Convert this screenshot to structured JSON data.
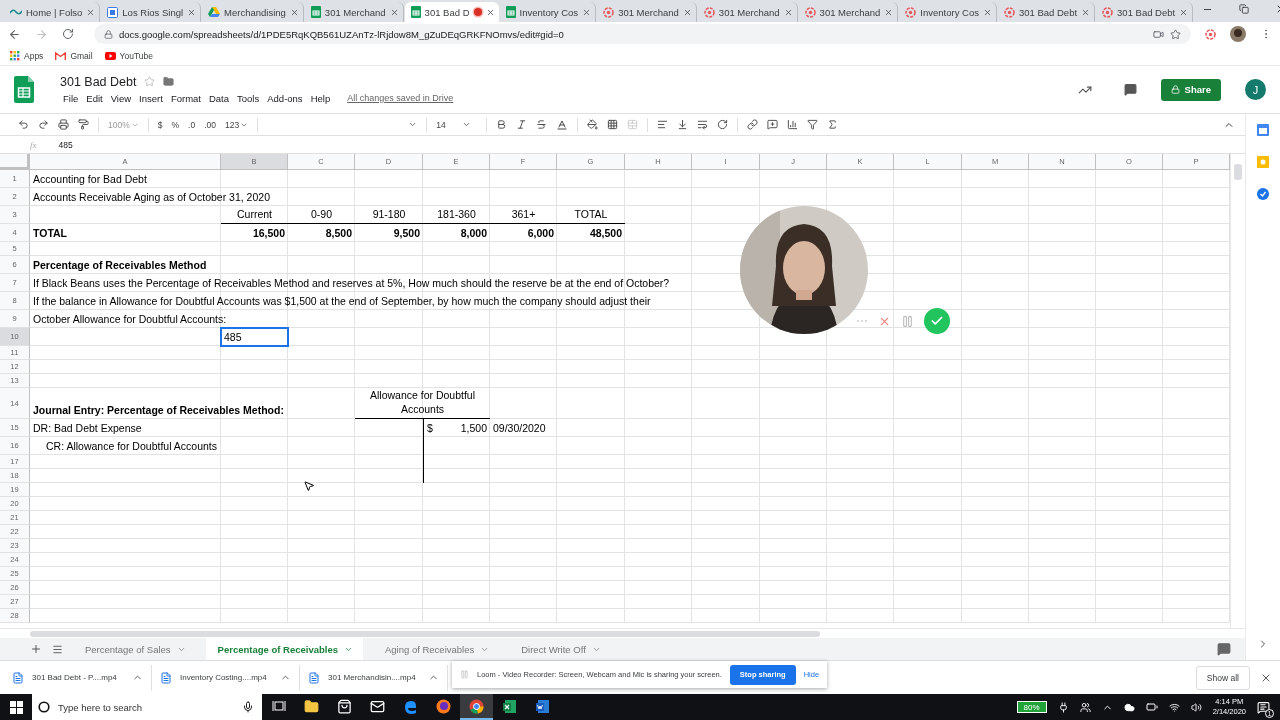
{
  "browser": {
    "tabs": [
      {
        "title": "Home | Folso",
        "kind": "site",
        "selected": false,
        "recording": false
      },
      {
        "title": "Los Rios Singl",
        "kind": "page",
        "selected": false,
        "recording": false
      },
      {
        "title": "Merchandising",
        "kind": "drive",
        "selected": false,
        "recording": false
      },
      {
        "title": "301 Merchand",
        "kind": "sheets",
        "selected": false,
        "recording": false
      },
      {
        "title": "301 Bad D",
        "kind": "sheets",
        "selected": true,
        "recording": true
      },
      {
        "title": "Inventory Cos",
        "kind": "sheets",
        "selected": false,
        "recording": false
      },
      {
        "title": "301 Merchand",
        "kind": "loom",
        "selected": false,
        "recording": false
      },
      {
        "title": "301 Merchand",
        "kind": "loom",
        "selected": false,
        "recording": false
      },
      {
        "title": "301 Merchand",
        "kind": "loom",
        "selected": false,
        "recording": false
      },
      {
        "title": "Inventory Cos",
        "kind": "loom",
        "selected": false,
        "recording": false
      },
      {
        "title": "301 Bad Debt",
        "kind": "loom",
        "selected": false,
        "recording": false
      },
      {
        "title": "301 Bad Debt",
        "kind": "loom",
        "selected": false,
        "recording": false
      }
    ],
    "url": "docs.google.com/spreadsheets/d/1PDE5RqKQB561UZAnTz-lRjdow8M_gZuDEqGRKFNOmvs/edit#gid=0",
    "bookmarks": [
      {
        "label": "Apps",
        "kind": "apps"
      },
      {
        "label": "Gmail",
        "kind": "gmail"
      },
      {
        "label": "YouTube",
        "kind": "youtube"
      }
    ]
  },
  "sheet_app": {
    "title": "301 Bad Debt",
    "menus": [
      "File",
      "Edit",
      "View",
      "Insert",
      "Format",
      "Data",
      "Tools",
      "Add-ons",
      "Help"
    ],
    "save_status": "All changes saved in Drive",
    "share": "Share",
    "avatar": "J",
    "toolbar": {
      "zoom": {
        "label": "100%",
        "disabled": true
      },
      "currency": "$",
      "percent": "%",
      "decrease_decimals": ".0",
      "increase_decimals": ".00",
      "more_formats": "123",
      "font_size": "14"
    },
    "formula_label": "fx",
    "formula": "485",
    "columns": [
      "A",
      "B",
      "C",
      "D",
      "E",
      "F",
      "G",
      "H",
      "I",
      "J",
      "K",
      "L",
      "M",
      "N",
      "O",
      "P"
    ],
    "rows": [
      {
        "number": "1",
        "cells": [
          {
            "kind": "text",
            "text": "Accounting for Bad Debt",
            "bold": false,
            "selected": false
          }
        ]
      },
      {
        "number": "2",
        "cells": [
          {
            "kind": "text",
            "text": "Accounts Receivable Aging as of October 31, 2020",
            "bold": false,
            "selected": false
          }
        ]
      },
      {
        "number": "3",
        "cells": [
          null,
          {
            "kind": "header",
            "text": "Current",
            "bold": false,
            "border_bottom": true,
            "selected": false
          },
          {
            "kind": "header",
            "text": "0-90",
            "bold": false,
            "border_bottom": true,
            "selected": false
          },
          {
            "kind": "header",
            "text": "91-180",
            "bold": false,
            "border_bottom": true,
            "selected": false
          },
          {
            "kind": "header",
            "text": "181-360",
            "bold": false,
            "border_bottom": true,
            "selected": false
          },
          {
            "kind": "header",
            "text": "361+",
            "bold": false,
            "border_bottom": true,
            "selected": false
          },
          {
            "kind": "header",
            "text": "TOTAL",
            "bold": false,
            "border_bottom": true,
            "selected": false
          }
        ]
      },
      {
        "number": "4",
        "cells": [
          {
            "kind": "text",
            "text": "TOTAL",
            "bold": true,
            "selected": false
          },
          {
            "kind": "number",
            "text": "16,500",
            "bold": true,
            "selected": false
          },
          {
            "kind": "number",
            "text": "8,500",
            "bold": true,
            "selected": false
          },
          {
            "kind": "number",
            "text": "9,500",
            "bold": true,
            "selected": false
          },
          {
            "kind": "number",
            "text": "8,000",
            "bold": true,
            "selected": false
          },
          {
            "kind": "number",
            "text": "6,000",
            "bold": true,
            "selected": false
          },
          {
            "kind": "number",
            "text": "48,500",
            "bold": true,
            "selected": false
          }
        ]
      },
      {
        "number": "5"
      },
      {
        "number": "6",
        "cells": [
          {
            "kind": "text",
            "text": "Percentage of Receivables Method",
            "bold": true,
            "selected": false
          }
        ]
      },
      {
        "number": "7",
        "cells": [
          {
            "kind": "text",
            "text": "If Black Beans uses the Percentage of Receivables Method and reserves at 5%, How much should the reserve be at the end of October?",
            "bold": false,
            "selected": false
          }
        ]
      },
      {
        "number": "8",
        "cells": [
          {
            "kind": "text",
            "text": "If the balance in Allowance for Doubtful Accounts was $1,500 at the end of September, by how much the company should adjust their",
            "bold": false,
            "selected": false
          }
        ]
      },
      {
        "number": "9",
        "cells": [
          {
            "kind": "text",
            "text": "October Allowance for Doubtful Accounts:",
            "bold": false,
            "selected": false
          }
        ]
      },
      {
        "number": "10",
        "cells": [
          null,
          {
            "kind": "text",
            "text": "485",
            "bold": false,
            "selected": true
          }
        ]
      },
      {
        "number": "11"
      },
      {
        "number": "12"
      },
      {
        "number": "13"
      },
      {
        "number": "14",
        "cells": [
          {
            "kind": "text",
            "text": "Journal Entry: Percentage of Receivables Method:",
            "bold": true,
            "selected": false
          },
          null,
          null,
          {
            "kind": "merged_header",
            "text": "Allowance for Doubtful Accounts",
            "bold": false,
            "border_bottom": true,
            "selected": false
          }
        ]
      },
      {
        "number": "15",
        "cells": [
          {
            "kind": "text",
            "text": "DR:  Bad Debt Expense",
            "bold": false,
            "selected": false
          },
          null,
          null,
          null,
          {
            "kind": "amount",
            "currency": "$",
            "text": "1,500",
            "bold": false,
            "border_left": true,
            "selected": false
          },
          {
            "kind": "text",
            "text": "09/30/2020",
            "bold": false,
            "selected": false
          }
        ]
      },
      {
        "number": "16",
        "cells": [
          {
            "kind": "indented",
            "text": "CR:  Allowance for Doubtful Accounts",
            "bold": false,
            "selected": false
          },
          null,
          null,
          null,
          {
            "kind": "blank",
            "border_left": true,
            "selected": false
          }
        ]
      },
      {
        "number": "17",
        "cells": [
          null,
          null,
          null,
          null,
          {
            "kind": "blank",
            "border_left": true,
            "selected": false
          }
        ]
      },
      {
        "number": "18",
        "cells": [
          null,
          null,
          null,
          null,
          {
            "kind": "blank",
            "border_left": true,
            "selected": false
          }
        ]
      },
      {
        "number": "19"
      },
      {
        "number": "20"
      },
      {
        "number": "21"
      },
      {
        "number": "22"
      },
      {
        "number": "23"
      },
      {
        "number": "24"
      },
      {
        "number": "25"
      },
      {
        "number": "26"
      },
      {
        "number": "27"
      },
      {
        "number": "28"
      }
    ],
    "sheets": [
      {
        "label": "Percentage of Sales",
        "selected": false
      },
      {
        "label": "Percentage of Receivables",
        "selected": true
      },
      {
        "label": "Aging of Receivables",
        "selected": false
      },
      {
        "label": "Direct Write Off",
        "selected": false
      }
    ]
  },
  "downloads": {
    "items": [
      "301 Bad Debt - P....mp4",
      "Inventory Costing....mp4",
      "301 Merchandisin....mp4"
    ],
    "show_all": "Show all"
  },
  "sharing_bar": {
    "message": "Loom - Video Recorder: Screen, Webcam and Mic is sharing your screen.",
    "stop": "Stop sharing",
    "hide": "Hide"
  },
  "taskbar": {
    "search_placeholder": "Type here to search",
    "apps": [
      {
        "kind": "taskview",
        "selected": false
      },
      {
        "kind": "explorer",
        "selected": false
      },
      {
        "kind": "store",
        "selected": false
      },
      {
        "kind": "mail",
        "selected": false
      },
      {
        "kind": "edge",
        "selected": false
      },
      {
        "kind": "firefox",
        "selected": false
      },
      {
        "kind": "chrome",
        "selected": true
      },
      {
        "kind": "excel",
        "selected": false
      },
      {
        "kind": "word",
        "selected": false
      }
    ],
    "battery": "80%",
    "time": "4:14 PM",
    "date": "2/14/2020",
    "notifications": "1"
  }
}
